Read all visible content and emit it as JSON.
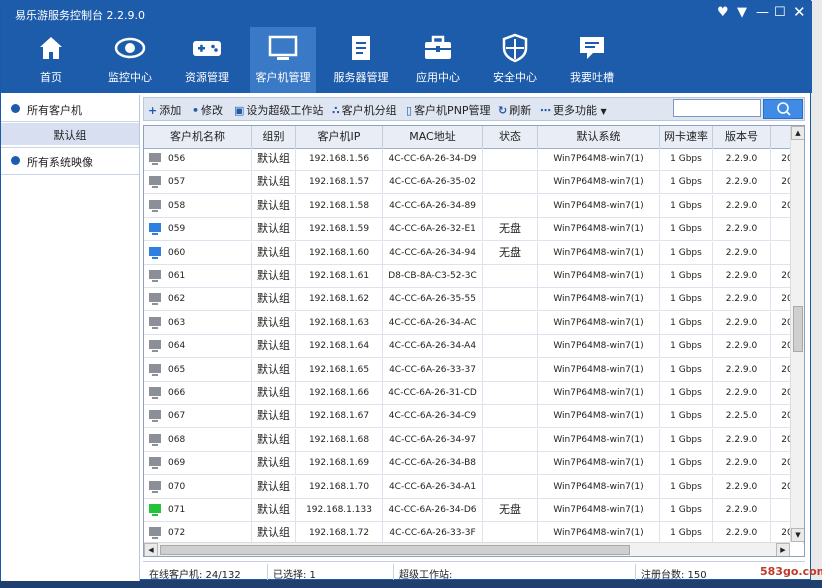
{
  "window": {
    "title": "易乐游服务控制台 2.2.9.0"
  },
  "nav": [
    {
      "label": "首页",
      "icon": "home-icon"
    },
    {
      "label": "监控中心",
      "icon": "eye-icon"
    },
    {
      "label": "资源管理",
      "icon": "gamepad-icon"
    },
    {
      "label": "客户机管理",
      "icon": "monitor-icon"
    },
    {
      "label": "服务器管理",
      "icon": "document-icon"
    },
    {
      "label": "应用中心",
      "icon": "toolbox-icon"
    },
    {
      "label": "安全中心",
      "icon": "shield-icon"
    },
    {
      "label": "我要吐槽",
      "icon": "message-icon"
    }
  ],
  "sidebar": {
    "all_clients": "所有客户机",
    "default_group": "默认组",
    "all_images": "所有系统映像"
  },
  "toolbar": {
    "add": "添加",
    "edit": "修改",
    "set_super": "设为超级工作站",
    "client_group": "客户机分组",
    "pnp": "客户机PNP管理",
    "refresh": "刷新",
    "more": "更多功能"
  },
  "table": {
    "columns": [
      "客户机名称",
      "组别",
      "客户机IP",
      "MAC地址",
      "状态",
      "默认系统",
      "网卡速率",
      "版本号",
      ""
    ],
    "rows": [
      {
        "name": "056",
        "group": "默认组",
        "ip": "192.168.1.56",
        "mac": "4C-CC-6A-26-34-D9",
        "status": "",
        "system": "Win7P64M8-win7(1)",
        "speed": "1 Gbps",
        "version": "2.2.9.0",
        "extra": "20",
        "pc": "offline"
      },
      {
        "name": "057",
        "group": "默认组",
        "ip": "192.168.1.57",
        "mac": "4C-CC-6A-26-35-02",
        "status": "",
        "system": "Win7P64M8-win7(1)",
        "speed": "1 Gbps",
        "version": "2.2.9.0",
        "extra": "20",
        "pc": "offline"
      },
      {
        "name": "058",
        "group": "默认组",
        "ip": "192.168.1.58",
        "mac": "4C-CC-6A-26-34-89",
        "status": "",
        "system": "Win7P64M8-win7(1)",
        "speed": "1 Gbps",
        "version": "2.2.9.0",
        "extra": "20",
        "pc": "offline"
      },
      {
        "name": "059",
        "group": "默认组",
        "ip": "192.168.1.59",
        "mac": "4C-CC-6A-26-32-E1",
        "status": "无盘",
        "system": "Win7P64M8-win7(1)",
        "speed": "1 Gbps",
        "version": "2.2.9.0",
        "extra": "",
        "pc": "online"
      },
      {
        "name": "060",
        "group": "默认组",
        "ip": "192.168.1.60",
        "mac": "4C-CC-6A-26-34-94",
        "status": "无盘",
        "system": "Win7P64M8-win7(1)",
        "speed": "1 Gbps",
        "version": "2.2.9.0",
        "extra": "",
        "pc": "online"
      },
      {
        "name": "061",
        "group": "默认组",
        "ip": "192.168.1.61",
        "mac": "D8-CB-8A-C3-52-3C",
        "status": "",
        "system": "Win7P64M8-win7(1)",
        "speed": "1 Gbps",
        "version": "2.2.9.0",
        "extra": "20",
        "pc": "offline"
      },
      {
        "name": "062",
        "group": "默认组",
        "ip": "192.168.1.62",
        "mac": "4C-CC-6A-26-35-55",
        "status": "",
        "system": "Win7P64M8-win7(1)",
        "speed": "1 Gbps",
        "version": "2.2.9.0",
        "extra": "20",
        "pc": "offline"
      },
      {
        "name": "063",
        "group": "默认组",
        "ip": "192.168.1.63",
        "mac": "4C-CC-6A-26-34-AC",
        "status": "",
        "system": "Win7P64M8-win7(1)",
        "speed": "1 Gbps",
        "version": "2.2.9.0",
        "extra": "20",
        "pc": "offline"
      },
      {
        "name": "064",
        "group": "默认组",
        "ip": "192.168.1.64",
        "mac": "4C-CC-6A-26-34-A4",
        "status": "",
        "system": "Win7P64M8-win7(1)",
        "speed": "1 Gbps",
        "version": "2.2.9.0",
        "extra": "20",
        "pc": "offline"
      },
      {
        "name": "065",
        "group": "默认组",
        "ip": "192.168.1.65",
        "mac": "4C-CC-6A-26-33-37",
        "status": "",
        "system": "Win7P64M8-win7(1)",
        "speed": "1 Gbps",
        "version": "2.2.9.0",
        "extra": "20",
        "pc": "offline"
      },
      {
        "name": "066",
        "group": "默认组",
        "ip": "192.168.1.66",
        "mac": "4C-CC-6A-26-31-CD",
        "status": "",
        "system": "Win7P64M8-win7(1)",
        "speed": "1 Gbps",
        "version": "2.2.9.0",
        "extra": "20",
        "pc": "offline"
      },
      {
        "name": "067",
        "group": "默认组",
        "ip": "192.168.1.67",
        "mac": "4C-CC-6A-26-34-C9",
        "status": "",
        "system": "Win7P64M8-win7(1)",
        "speed": "1 Gbps",
        "version": "2.2.5.0",
        "extra": "20",
        "pc": "offline"
      },
      {
        "name": "068",
        "group": "默认组",
        "ip": "192.168.1.68",
        "mac": "4C-CC-6A-26-34-97",
        "status": "",
        "system": "Win7P64M8-win7(1)",
        "speed": "1 Gbps",
        "version": "2.2.9.0",
        "extra": "20",
        "pc": "offline"
      },
      {
        "name": "069",
        "group": "默认组",
        "ip": "192.168.1.69",
        "mac": "4C-CC-6A-26-34-B8",
        "status": "",
        "system": "Win7P64M8-win7(1)",
        "speed": "1 Gbps",
        "version": "2.2.9.0",
        "extra": "20",
        "pc": "offline"
      },
      {
        "name": "070",
        "group": "默认组",
        "ip": "192.168.1.70",
        "mac": "4C-CC-6A-26-34-A1",
        "status": "",
        "system": "Win7P64M8-win7(1)",
        "speed": "1 Gbps",
        "version": "2.2.9.0",
        "extra": "20",
        "pc": "offline"
      },
      {
        "name": "071",
        "group": "默认组",
        "ip": "192.168.1.133",
        "mac": "4C-CC-6A-26-34-D6",
        "status": "无盘",
        "system": "Win7P64M8-win7(1)",
        "speed": "1 Gbps",
        "version": "2.2.9.0",
        "extra": "",
        "pc": "green"
      },
      {
        "name": "072",
        "group": "默认组",
        "ip": "192.168.1.72",
        "mac": "4C-CC-6A-26-33-3F",
        "status": "",
        "system": "Win7P64M8-win7(1)",
        "speed": "1 Gbps",
        "version": "2.2.9.0",
        "extra": "20",
        "pc": "offline"
      }
    ]
  },
  "statusbar": {
    "online": "在线客户机: 24/132",
    "selected": "已选择: 1",
    "super": "超级工作站:",
    "registered": "注册台数: 150"
  },
  "watermark": "583go.com",
  "colors": {
    "accent": "#1d5bab",
    "active_nav": "#3a79c6",
    "search": "#3f8be6"
  }
}
